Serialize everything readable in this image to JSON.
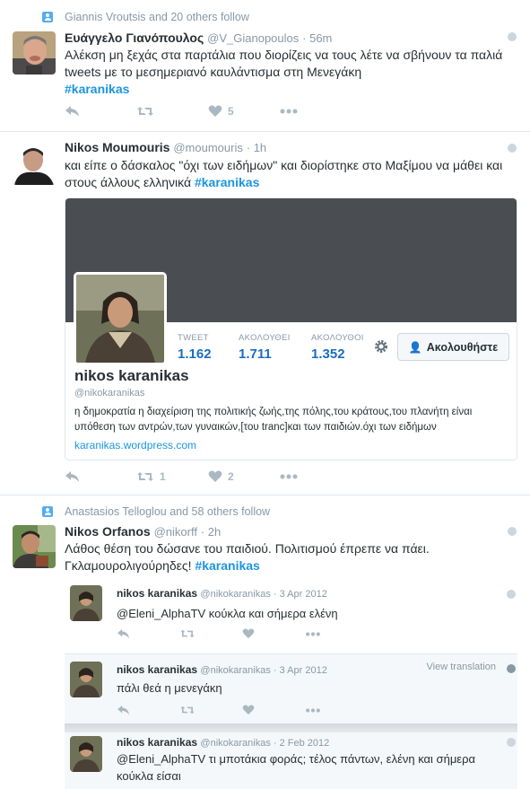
{
  "tweets": [
    {
      "context": "Giannis Vroutsis and 20 others follow",
      "name": "Ευάγγελο Γιανόπουλος",
      "handle": "@V_Gianopoulos",
      "time": "· 56m",
      "text": "Αλέκση μη ξεχάς στα παρτάλια που διορίζεις να τους λέτε να σβήνουν τα παλιά tweets με το μεσημεριανό καυλάντισμα στη Μενεγάκη",
      "hashtag": "#karanikas",
      "likes": "5"
    },
    {
      "name": "Nikos Moumouris",
      "handle": "@moumouris",
      "time": "· 1h",
      "text": "και είπε ο δάσκαλος \"όχι των ειδήμων\" και διορίστηκε στο Μαξίμου να μάθει και στους άλλους ελληνικά",
      "hashtag": "#karanikas",
      "retweets": "1",
      "likes": "2",
      "card": {
        "tweets_label": "TWEET",
        "tweets_value": "1.162",
        "following_label": "ΑΚΟΛΟΥΘΕΙ",
        "following_value": "1.711",
        "followers_label": "ΑΚΟΛΟΥΘΟΙ",
        "followers_value": "1.352",
        "follow_button": "Ακολουθήστε",
        "name": "nikos karanikas",
        "handle": "@nikokaranikas",
        "bio": "η δημοκρατία η διαχείριση της πολιτικής ζωής,της πόλης,του κράτους,του πλανήτη είναι υπόθεση των αντρών,των γυναικών,[του tranc]και των παιδιών.όχι των ειδήμων",
        "url": "karanikas.wordpress.com"
      }
    },
    {
      "context": "Anastasios Telloglou and 58 others follow",
      "name": "Nikos Orfanos",
      "handle": "@nikorff",
      "time": "· 2h",
      "text": "Λάθος θέση του δώσανε του παιδιού. Πολιτισμού έπρεπε να πάει. Γκλαμουρολιγούρηδες!",
      "hashtag": "#karanikas",
      "replies": [
        {
          "name": "nikos karanikas",
          "meta": "@nikokaranikas · 3 Apr 2012",
          "text": "@Eleni_AlphaTV κούκλα και σήμερα ελένη"
        },
        {
          "name": "nikos karanikas",
          "meta": "@nikokaranikas · 3 Apr 2012",
          "text": "πάλι θεά η μενεγάκη",
          "view_translation": "View translation"
        },
        {
          "name": "nikos karanikas",
          "meta": "@nikokaranikas · 2 Feb 2012",
          "text": "@Eleni_AlphaTV τι μποτάκια φοράς; τέλος πάντων, ελένη και σήμερα κούκλα είσαι"
        }
      ]
    }
  ],
  "colors": {
    "link": "#1b95e0",
    "muted": "#8899a6",
    "icon": "#aab8c2",
    "context_icon": "#55acee"
  }
}
